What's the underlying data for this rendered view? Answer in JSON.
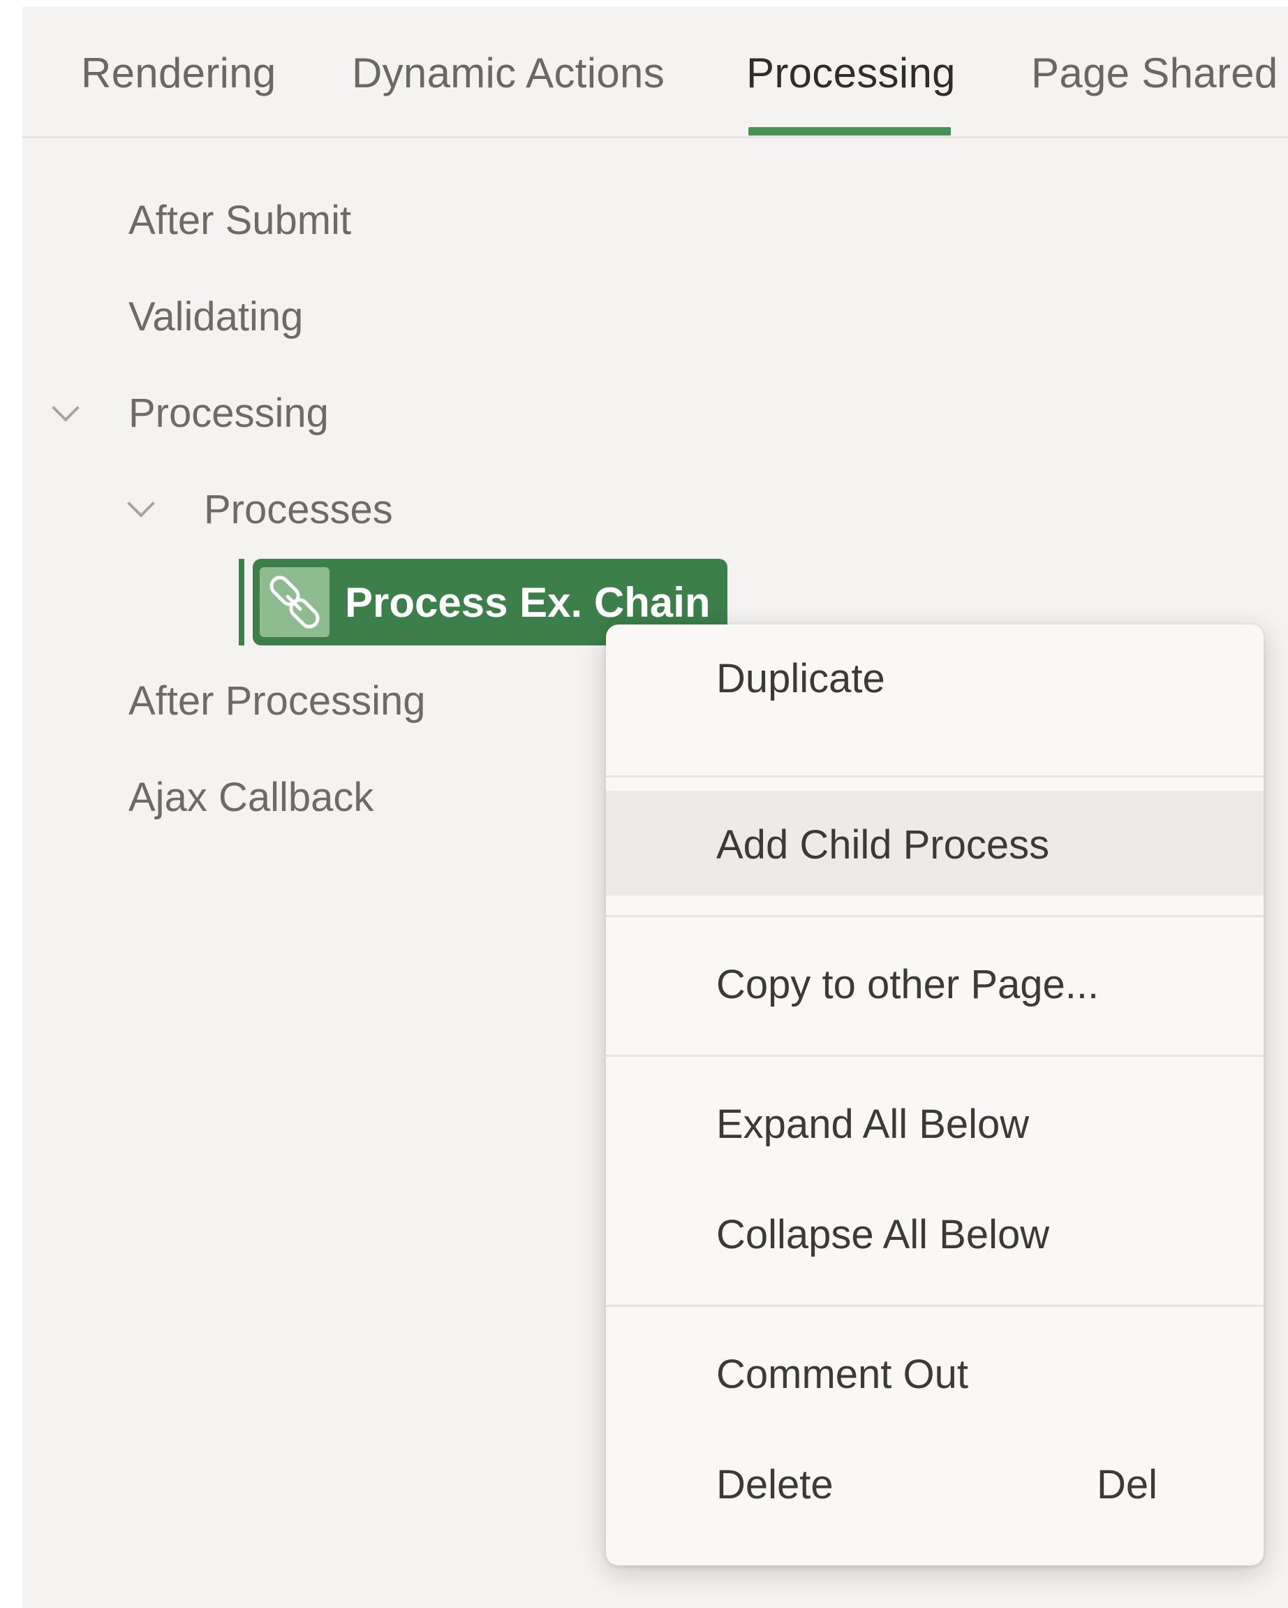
{
  "tabs": [
    {
      "label": "Rendering"
    },
    {
      "label": "Dynamic Actions"
    },
    {
      "label": "Processing",
      "active": true
    },
    {
      "label": "Page Shared C"
    }
  ],
  "tree": {
    "after_submit": "After Submit",
    "validating": "Validating",
    "processing": "Processing",
    "processes": "Processes",
    "selected_node": "Process Ex. Chain",
    "after_processing": "After Processing",
    "ajax_callback": "Ajax Callback"
  },
  "context_menu": {
    "items": [
      {
        "label": "Duplicate"
      },
      {
        "label": "Add Child Process"
      },
      {
        "label": "Copy to other Page..."
      },
      {
        "label": "Expand All Below"
      },
      {
        "label": "Collapse All Below"
      },
      {
        "label": "Comment Out"
      },
      {
        "label": "Delete",
        "shortcut": "Del"
      }
    ]
  },
  "colors": {
    "accent": "#3c7f4a",
    "tab_indicator": "#4a8f57",
    "panel_bg": "#f5f3f2",
    "menu_bg": "#f9f8f7"
  }
}
